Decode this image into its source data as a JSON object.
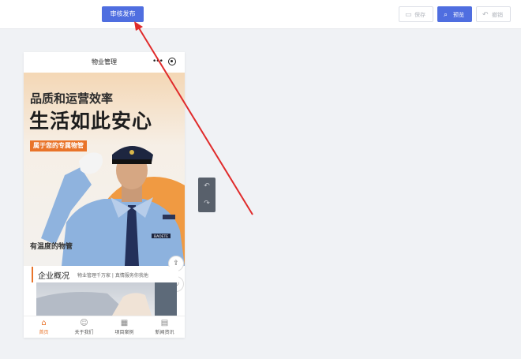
{
  "toolbar": {
    "publish_label": "审核发布",
    "save_label": "保存",
    "preview_label": "预览",
    "undo_label": "撤销"
  },
  "phone": {
    "title": "物业管理",
    "banner": {
      "line1": "品质和运营效率",
      "line2": "生活如此安心",
      "tag": "属于您的专属物管",
      "care": "有温度的物管",
      "badge": "BAOETE"
    },
    "overview": {
      "title": "企业概况",
      "subtitle": "物业管理千万家 | 真情服务你我他"
    },
    "tabs": [
      {
        "label": "首页",
        "icon": "home-icon"
      },
      {
        "label": "关于我们",
        "icon": "people-icon"
      },
      {
        "label": "项目案例",
        "icon": "grid-icon"
      },
      {
        "label": "新闻资讯",
        "icon": "news-icon"
      }
    ]
  },
  "colors": {
    "accent": "#4f6ee0",
    "brand_orange": "#e9742a",
    "annotation_red": "#e02b2b"
  }
}
